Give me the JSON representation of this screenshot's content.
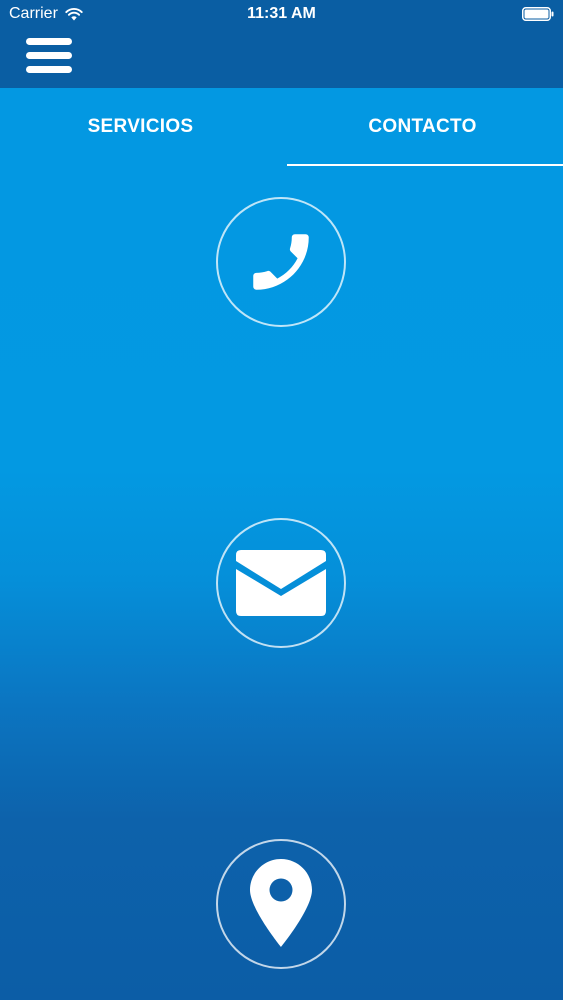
{
  "status_bar": {
    "carrier": "Carrier",
    "time": "11:31 AM",
    "wifi_icon": "wifi-icon",
    "battery_icon": "battery-icon"
  },
  "nav_bar": {
    "menu_icon": "hamburger-menu-icon"
  },
  "tabs": [
    {
      "label": "SERVICIOS",
      "selected": false
    },
    {
      "label": "CONTACTO",
      "selected": true
    }
  ],
  "contact_options": [
    {
      "icon": "phone-icon"
    },
    {
      "icon": "envelope-icon"
    },
    {
      "icon": "location-pin-icon"
    }
  ],
  "colors": {
    "nav_background": "#0a5ea3",
    "content_top": "#0399e2",
    "content_bottom": "#0c5da6",
    "foreground": "#ffffff"
  }
}
